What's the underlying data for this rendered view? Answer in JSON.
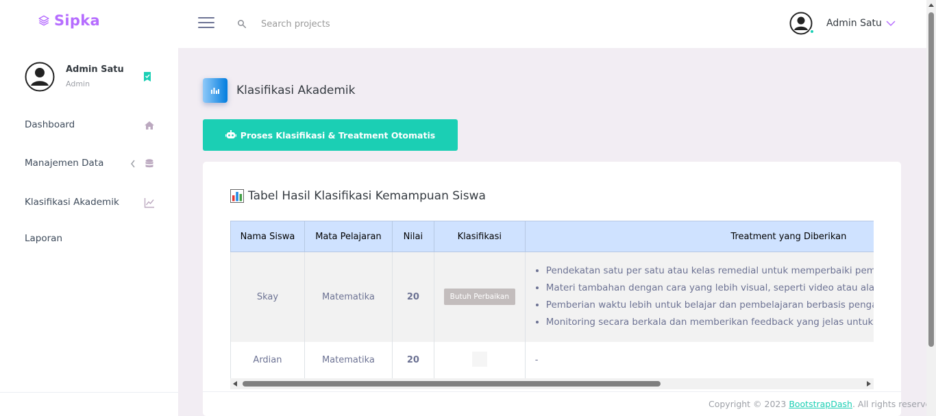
{
  "brand": {
    "name": "Sipka"
  },
  "navbar": {
    "search_placeholder": "Search projects",
    "profile_name": "Admin Satu"
  },
  "sidebar": {
    "profile": {
      "name": "Admin Satu",
      "role": "Admin"
    },
    "items": [
      {
        "label": "Dashboard",
        "icon": "home-icon"
      },
      {
        "label": "Manajemen Data",
        "icon": "database-icon",
        "has_submenu": true
      },
      {
        "label": "Klasifikasi Akademik",
        "icon": "chart-line-icon"
      },
      {
        "label": "Laporan"
      }
    ]
  },
  "page": {
    "title": "Klasifikasi Akademik",
    "process_button": "Proses Klasifikasi & Treatment Otomatis"
  },
  "card": {
    "title": "Tabel Hasil Klasifikasi Kemampuan Siswa",
    "table": {
      "headers": [
        "Nama Siswa",
        "Mata Pelajaran",
        "Nilai",
        "Klasifikasi",
        "Treatment yang Diberikan"
      ],
      "rows": [
        {
          "nama": "Skay",
          "mapel": "Matematika",
          "nilai": "20",
          "klasifikasi": "Butuh Perbaikan",
          "treatment": [
            "Pendekatan satu per satu atau kelas remedial untuk memperbaiki pemaham",
            "Materi tambahan dengan cara yang lebih visual, seperti video atau alat bant",
            "Pemberian waktu lebih untuk belajar dan pembelajaran berbasis pengalama",
            "Monitoring secara berkala dan memberikan feedback yang jelas untuk mem"
          ]
        },
        {
          "nama": "Ardian",
          "mapel": "Matematika",
          "nilai": "20",
          "klasifikasi": "",
          "treatment_text": "-"
        }
      ]
    }
  },
  "footer": {
    "prefix": "Copyright © 2023 ",
    "link": "BootstrapDash",
    "suffix": ". All rights reserved."
  },
  "colors": {
    "brand": "#b66dff",
    "success": "#1bcfb4",
    "table_header": "#cfe2ff",
    "badge": "#c3bdbd"
  }
}
